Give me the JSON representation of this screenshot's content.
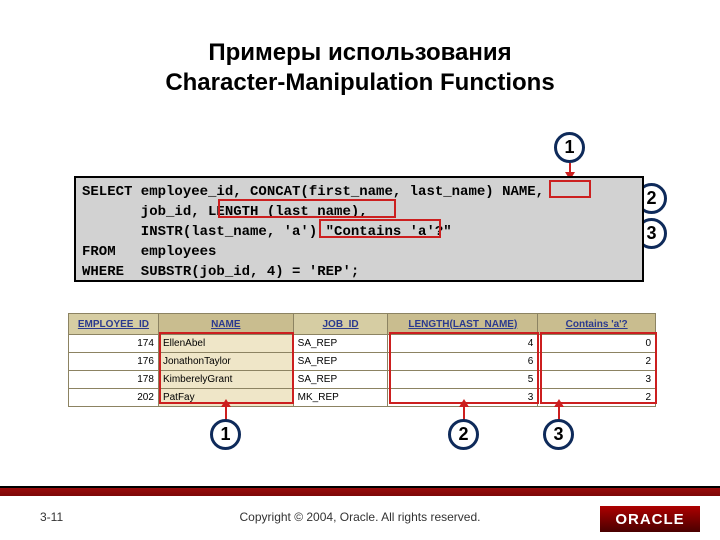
{
  "title_line1": "Примеры использования",
  "title_line2": "Character-Manipulation Functions",
  "code": "SELECT employee_id, CONCAT(first_name, last_name) NAME,\n       job_id, LENGTH (last_name),\n       INSTR(last_name, 'a') \"Contains 'a'?\"\nFROM   employees\nWHERE  SUBSTR(job_id, 4) = 'REP';",
  "badges_top": {
    "b1": "1",
    "b2": "2",
    "b3": "3"
  },
  "badges_bottom": {
    "b1": "1",
    "b2": "2",
    "b3": "3"
  },
  "table": {
    "headers": [
      "EMPLOYEE_ID",
      "NAME",
      "JOB_ID",
      "LENGTH(LAST_NAME)",
      "Contains 'a'?"
    ],
    "rows": [
      {
        "employee_id": "174",
        "name": "EllenAbel",
        "job_id": "SA_REP",
        "len": "4",
        "contains": "0"
      },
      {
        "employee_id": "176",
        "name": "JonathonTaylor",
        "job_id": "SA_REP",
        "len": "6",
        "contains": "2"
      },
      {
        "employee_id": "178",
        "name": "KimberelyGrant",
        "job_id": "SA_REP",
        "len": "5",
        "contains": "3"
      },
      {
        "employee_id": "202",
        "name": "PatFay",
        "job_id": "MK_REP",
        "len": "3",
        "contains": "2"
      }
    ]
  },
  "footer": {
    "page": "3-11",
    "copyright": "Copyright © 2004, Oracle.  All rights reserved.",
    "logo": "ORACLE"
  }
}
